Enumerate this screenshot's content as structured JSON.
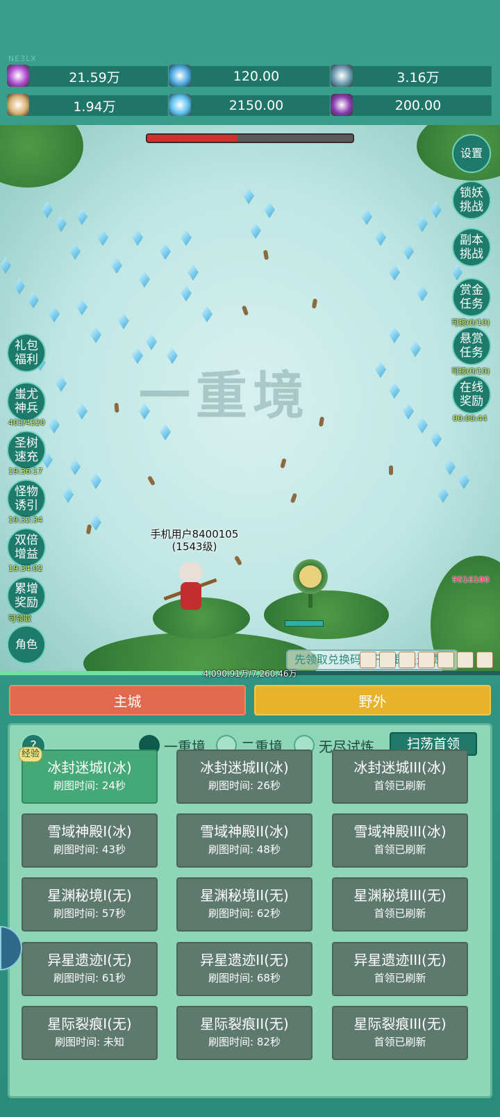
{
  "watermark": "NE3LX",
  "resources": [
    {
      "icon": "purple-gem-icon",
      "value": "21.59万",
      "color": "#b04ad0"
    },
    {
      "icon": "blue-orb-icon",
      "value": "120.00",
      "color": "#4aa8e0"
    },
    {
      "icon": "planet-icon",
      "value": "3.16万",
      "color": "#6a9ab0"
    },
    {
      "icon": "scroll-icon",
      "value": "1.94万",
      "color": "#d8b070"
    },
    {
      "icon": "ice-crystal-icon",
      "value": "2150.00",
      "color": "#5ac0f0"
    },
    {
      "icon": "potion-icon",
      "value": "200.00",
      "color": "#8a3ab0"
    }
  ],
  "scene": {
    "boss_hp_fraction": 0.44,
    "realm_watermark": "一重境",
    "player_name": "手机用户8400105",
    "player_level": "(1543级)",
    "tip": "先领取兑换码，开局即遥遥领先",
    "damage_number": "9516100",
    "exp_text": "4,090.91万/7,260.46万",
    "exp_fraction": 0.56
  },
  "right_buttons": [
    {
      "id": "settings",
      "label": "设置",
      "sub": ""
    },
    {
      "id": "lock-demon",
      "label": "锁妖挑战",
      "sub": ""
    },
    {
      "id": "dungeon",
      "label": "副本挑战",
      "sub": ""
    },
    {
      "id": "bounty-gold",
      "label": "赏金任务",
      "sub": "可接(0/10)"
    },
    {
      "id": "bounty-hang",
      "label": "悬赏任务",
      "sub": "可接(0/10)"
    },
    {
      "id": "online",
      "label": "在线奖励",
      "sub": "00:00:44"
    }
  ],
  "left_buttons": [
    {
      "id": "gift",
      "label": "礼包福利",
      "sub": ""
    },
    {
      "id": "weapon",
      "label": "蚩尤神兵",
      "sub": "403/4320"
    },
    {
      "id": "tree",
      "label": "圣树速充",
      "sub": "19:36:17"
    },
    {
      "id": "lure",
      "label": "怪物诱引",
      "sub": "19:32:34"
    },
    {
      "id": "double",
      "label": "双倍增益",
      "sub": "19:34:02"
    },
    {
      "id": "cumulative",
      "label": "累增奖励",
      "sub": "可领取"
    },
    {
      "id": "role",
      "label": "角色",
      "sub": ""
    }
  ],
  "tabs": {
    "main": "主城",
    "field": "野外"
  },
  "panel": {
    "help": "?",
    "realms": [
      "一重境",
      "二重境",
      "无尽试炼"
    ],
    "selected_realm": 0,
    "sweep": "扫荡首领",
    "exp_badge": "经验",
    "dungeons": [
      {
        "name": "冰封迷城I(冰)",
        "sub": "刷图时间: 24秒",
        "active": true
      },
      {
        "name": "冰封迷城II(冰)",
        "sub": "刷图时间: 26秒"
      },
      {
        "name": "冰封迷城III(冰)",
        "sub": "首领已刷新"
      },
      {
        "name": "雪域神殿I(冰)",
        "sub": "刷图时间: 43秒"
      },
      {
        "name": "雪域神殿II(冰)",
        "sub": "刷图时间: 48秒"
      },
      {
        "name": "雪域神殿III(冰)",
        "sub": "首领已刷新"
      },
      {
        "name": "星渊秘境I(无)",
        "sub": "刷图时间: 57秒"
      },
      {
        "name": "星渊秘境II(无)",
        "sub": "刷图时间: 62秒"
      },
      {
        "name": "星渊秘境III(无)",
        "sub": "首领已刷新"
      },
      {
        "name": "异星遗迹I(无)",
        "sub": "刷图时间: 61秒"
      },
      {
        "name": "异星遗迹II(无)",
        "sub": "刷图时间: 68秒"
      },
      {
        "name": "异星遗迹III(无)",
        "sub": "首领已刷新"
      },
      {
        "name": "星际裂痕I(无)",
        "sub": "刷图时间: 未知"
      },
      {
        "name": "星际裂痕II(无)",
        "sub": "刷图时间: 82秒"
      },
      {
        "name": "星际裂痕III(无)",
        "sub": "首领已刷新"
      }
    ]
  }
}
